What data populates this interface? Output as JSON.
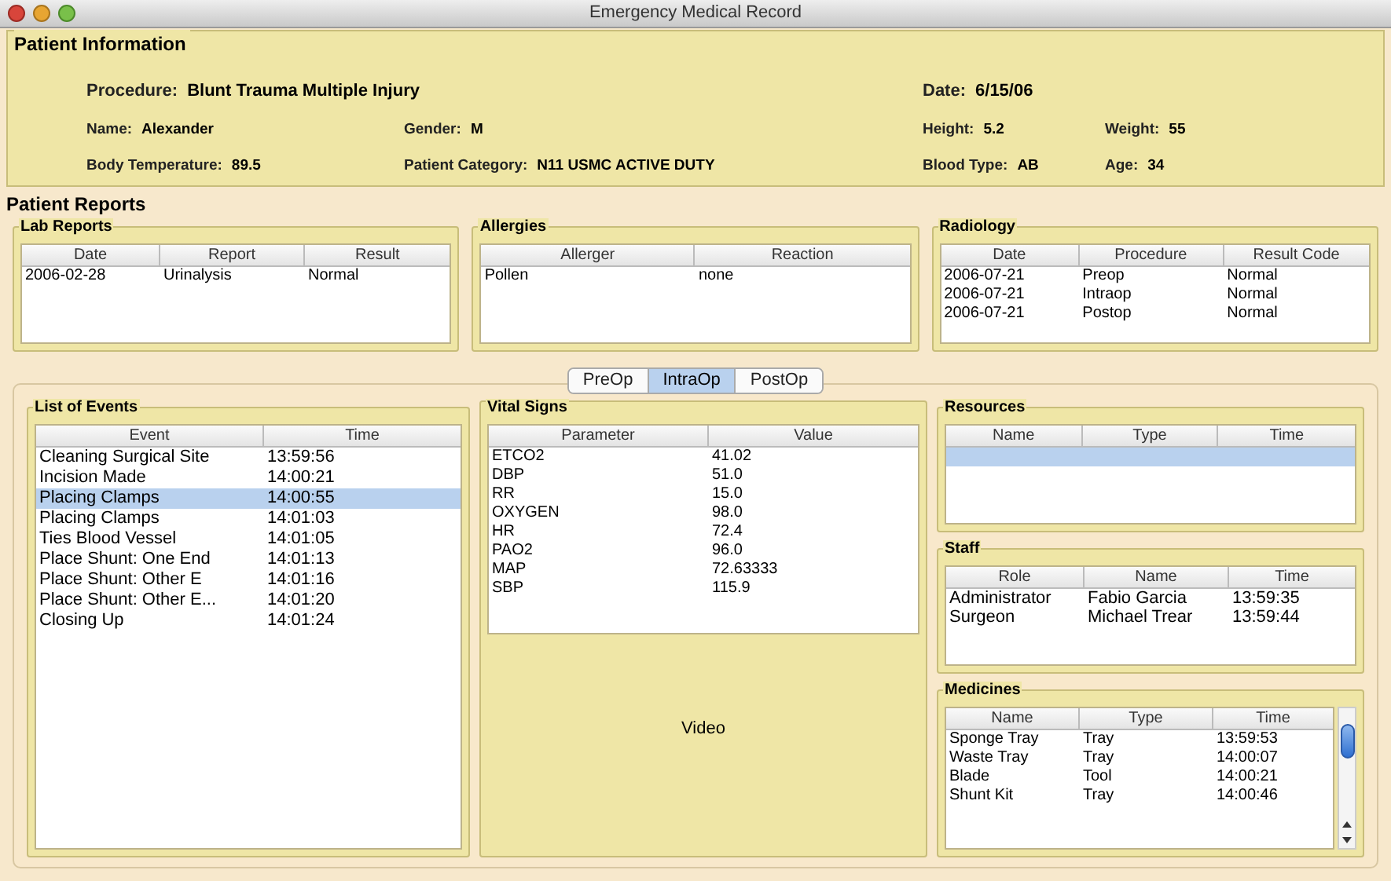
{
  "window": {
    "title": "Emergency Medical Record"
  },
  "patient_information": {
    "title": "Patient Information",
    "fields": [
      {
        "label": "Procedure:",
        "value": "Blunt Trauma Multiple Injury"
      },
      {
        "label": "Date:",
        "value": "6/15/06"
      },
      {
        "label": "Name:",
        "value": "Alexander"
      },
      {
        "label": "Gender:",
        "value": "M"
      },
      {
        "label": "Height:",
        "value": "5.2"
      },
      {
        "label": "Weight:",
        "value": "55"
      },
      {
        "label": "Body Temperature:",
        "value": "89.5"
      },
      {
        "label": "Patient Category:",
        "value": "N11 USMC ACTIVE DUTY"
      },
      {
        "label": "Blood Type:",
        "value": "AB"
      },
      {
        "label": "Age:",
        "value": "34"
      }
    ]
  },
  "patient_reports": {
    "title": "Patient Reports",
    "panels": [
      {
        "title": "Lab Reports",
        "columns": [
          "Date",
          "Report",
          "Result"
        ],
        "rows": [
          {
            "cells": [
              "2006-02-28",
              "Urinalysis",
              "Normal"
            ],
            "selected": false
          }
        ]
      },
      {
        "title": "Allergies",
        "columns": [
          "Allerger",
          "Reaction"
        ],
        "rows": [
          {
            "cells": [
              "Pollen",
              "none"
            ],
            "selected": false
          }
        ]
      },
      {
        "title": "Radiology",
        "columns": [
          "Date",
          "Procedure",
          "Result Code"
        ],
        "rows": [
          {
            "cells": [
              "2006-07-21",
              "Preop",
              "Normal"
            ],
            "selected": false
          },
          {
            "cells": [
              "2006-07-21",
              "Intraop",
              "Normal"
            ],
            "selected": false
          },
          {
            "cells": [
              "2006-07-21",
              "Postop",
              "Normal"
            ],
            "selected": false
          }
        ]
      }
    ]
  },
  "tabs": [
    {
      "label": "PreOp",
      "selected": false
    },
    {
      "label": "IntraOp",
      "selected": true
    },
    {
      "label": "PostOp",
      "selected": false
    }
  ],
  "list_of_events": {
    "title": "List of Events",
    "columns": [
      "Event",
      "Time"
    ],
    "rows": [
      {
        "cells": [
          "Cleaning Surgical Site",
          "13:59:56"
        ],
        "selected": false
      },
      {
        "cells": [
          "Incision Made",
          "14:00:21"
        ],
        "selected": false
      },
      {
        "cells": [
          "Placing Clamps",
          "14:00:55"
        ],
        "selected": true
      },
      {
        "cells": [
          "Placing Clamps",
          "14:01:03"
        ],
        "selected": false
      },
      {
        "cells": [
          "Ties Blood Vessel",
          "14:01:05"
        ],
        "selected": false
      },
      {
        "cells": [
          "Place Shunt: One End",
          "14:01:13"
        ],
        "selected": false
      },
      {
        "cells": [
          "Place Shunt: Other E",
          "14:01:16"
        ],
        "selected": false
      },
      {
        "cells": [
          "Place Shunt: Other E...",
          "14:01:20"
        ],
        "selected": false
      },
      {
        "cells": [
          "Closing Up",
          "14:01:24"
        ],
        "selected": false
      }
    ]
  },
  "vital_signs": {
    "title": "Vital Signs",
    "columns": [
      "Parameter",
      "Value"
    ],
    "rows": [
      {
        "cells": [
          "ETCO2",
          "41.02"
        ],
        "selected": false
      },
      {
        "cells": [
          "DBP",
          "51.0"
        ],
        "selected": false
      },
      {
        "cells": [
          "RR",
          "15.0"
        ],
        "selected": false
      },
      {
        "cells": [
          "OXYGEN",
          "98.0"
        ],
        "selected": false
      },
      {
        "cells": [
          "HR",
          "72.4"
        ],
        "selected": false
      },
      {
        "cells": [
          "PAO2",
          "96.0"
        ],
        "selected": false
      },
      {
        "cells": [
          "MAP",
          "72.63333"
        ],
        "selected": false
      },
      {
        "cells": [
          "SBP",
          "115.9"
        ],
        "selected": false
      }
    ]
  },
  "video": {
    "label": "Video"
  },
  "resources": {
    "title": "Resources",
    "columns": [
      "Name",
      "Type",
      "Time"
    ],
    "rows": [
      {
        "cells": [],
        "selected": true
      }
    ]
  },
  "staff": {
    "title": "Staff",
    "columns": [
      "Role",
      "Name",
      "Time"
    ],
    "rows": [
      {
        "cells": [
          "Administrator",
          "Fabio Garcia",
          "13:59:35"
        ],
        "selected": false
      },
      {
        "cells": [
          "Surgeon",
          "Michael Trear",
          "13:59:44"
        ],
        "selected": false
      }
    ]
  },
  "medicines": {
    "title": "Medicines",
    "columns": [
      "Name",
      "Type",
      "Time"
    ],
    "rows": [
      {
        "cells": [
          "Sponge Tray",
          "Tray",
          "13:59:53"
        ],
        "selected": false
      },
      {
        "cells": [
          "Waste Tray",
          "Tray",
          "14:00:07"
        ],
        "selected": false
      },
      {
        "cells": [
          "Blade",
          "Tool",
          "14:00:21"
        ],
        "selected": false
      },
      {
        "cells": [
          "Shunt Kit",
          "Tray",
          "14:00:46"
        ],
        "selected": false
      }
    ]
  }
}
